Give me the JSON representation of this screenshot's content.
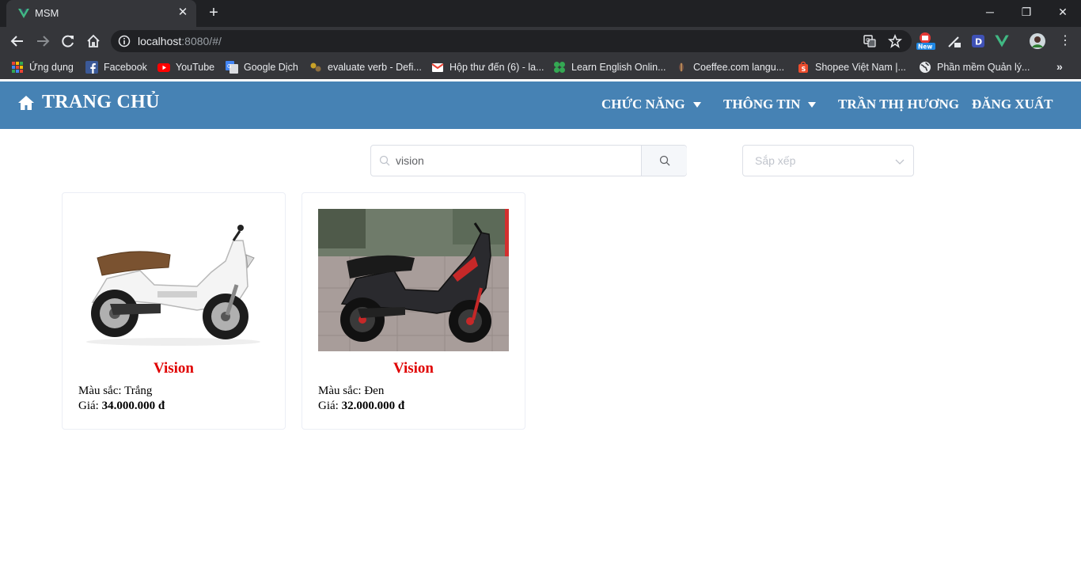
{
  "browser": {
    "tab_title": "MSM",
    "url_host": "localhost",
    "url_rest": ":8080/#/",
    "ext_badge": "New",
    "bookmarks": [
      {
        "label": "Ứng dụng",
        "icon": "apps-grid-icon"
      },
      {
        "label": "Facebook",
        "icon": "facebook-icon"
      },
      {
        "label": "YouTube",
        "icon": "youtube-icon"
      },
      {
        "label": "Google Dịch",
        "icon": "google-translate-icon"
      },
      {
        "label": "evaluate verb - Defi...",
        "icon": "dictionary-icon"
      },
      {
        "label": "Hộp thư đến (6) - la...",
        "icon": "gmail-icon"
      },
      {
        "label": "Learn English Onlin...",
        "icon": "clover-icon"
      },
      {
        "label": "Coeffee.com langu...",
        "icon": "coffee-icon"
      },
      {
        "label": "Shopee Việt Nam |...",
        "icon": "shopee-icon"
      },
      {
        "label": "Phần mềm Quản lý...",
        "icon": "globe-icon"
      }
    ]
  },
  "header": {
    "title": "TRANG CHỦ",
    "menu": {
      "features": "CHỨC NĂNG",
      "info": "THÔNG TIN",
      "user": "TRẦN THỊ HƯƠNG",
      "logout": "ĐĂNG XUẤT"
    }
  },
  "search": {
    "value": "vision",
    "sort_placeholder": "Sắp xếp"
  },
  "products": [
    {
      "name": "Vision",
      "color_label": "Màu sắc:",
      "color": "Trắng",
      "price_label": "Giá:",
      "price": "34.000.000 đ",
      "image": "white-scooter-image"
    },
    {
      "name": "Vision",
      "color_label": "Màu sắc:",
      "color": "Đen",
      "price_label": "Giá:",
      "price": "32.000.000 đ",
      "image": "black-scooter-photo"
    }
  ],
  "colors": {
    "header_bg": "#4682b4",
    "product_name": "#e00000",
    "browser_dark": "#202124",
    "browser_toolbar": "#35363a"
  }
}
